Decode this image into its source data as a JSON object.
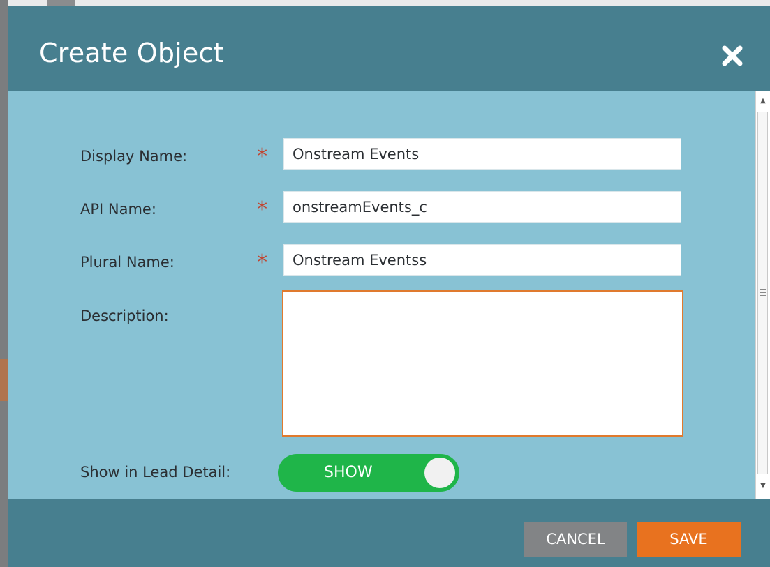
{
  "dialog": {
    "title": "Create Object",
    "close_icon": "close-icon"
  },
  "form": {
    "display_name": {
      "label": "Display Name:",
      "required": true,
      "value": "Onstream Events"
    },
    "api_name": {
      "label": "API Name:",
      "required": true,
      "value": "onstreamEvents_c"
    },
    "plural_name": {
      "label": "Plural Name:",
      "required": true,
      "value": "Onstream Eventss"
    },
    "description": {
      "label": "Description:",
      "value": ""
    },
    "show_in_lead_detail": {
      "label": "Show in Lead Detail:",
      "toggle_text": "SHOW",
      "on": true
    },
    "required_marker": "*"
  },
  "footer": {
    "cancel_label": "CANCEL",
    "save_label": "SAVE"
  },
  "colors": {
    "header": "#477f8f",
    "body": "#88c2d4",
    "required": "#c1432e",
    "toggle_on": "#1fb549",
    "cancel": "#828486",
    "save": "#e8721f",
    "textarea_focus": "#e07a2e"
  }
}
